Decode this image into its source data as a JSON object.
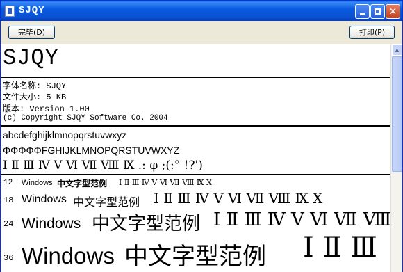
{
  "window": {
    "title": "SJQY"
  },
  "toolbar": {
    "complete_label": "完毕(D)",
    "print_label": "打印(P)"
  },
  "content": {
    "heading": "SJQY",
    "info": [
      "字体名称: SJQY",
      "文件大小: 5 KB",
      "版本: Version 1.00",
      "(c) Copyright SJQY Software Co. 2004"
    ],
    "charset": [
      "abcdefghijklmnopqrstuvwxyz",
      "ΦΦΦΦΦFGHIJKLMNOPQRSTUVWXYZ",
      "Ⅰ Ⅱ Ⅲ Ⅳ Ⅴ Ⅵ Ⅶ Ⅷ Ⅸ .: φ ;(:° !?')"
    ],
    "samples": [
      {
        "size": "12",
        "latin": "Windows",
        "cjk": "中文字型范例",
        "roman": "Ⅰ Ⅱ Ⅲ Ⅳ Ⅴ Ⅵ Ⅶ Ⅷ Ⅸ Ⅹ"
      },
      {
        "size": "18",
        "latin": "Windows",
        "cjk": "中文字型范例",
        "roman": "Ⅰ Ⅱ Ⅲ Ⅳ Ⅴ Ⅵ Ⅶ Ⅷ Ⅸ Ⅹ"
      },
      {
        "size": "24",
        "latin": "Windows",
        "cjk": "中文字型范例",
        "roman": "Ⅰ Ⅱ Ⅲ Ⅳ Ⅴ Ⅵ Ⅶ Ⅷ Ⅸ Ⅹ"
      },
      {
        "size": "36",
        "latin": "Windows",
        "cjk": "中文字型范例",
        "roman": "Ⅰ Ⅱ Ⅲ"
      }
    ]
  },
  "icons": {
    "app": "document-icon",
    "minimize": "minimize-icon",
    "maximize": "maximize-icon",
    "close": "close-icon"
  },
  "colors": {
    "titlebar": "#0A5BE0",
    "close_button": "#C3421D",
    "face": "#ECE9D8"
  }
}
